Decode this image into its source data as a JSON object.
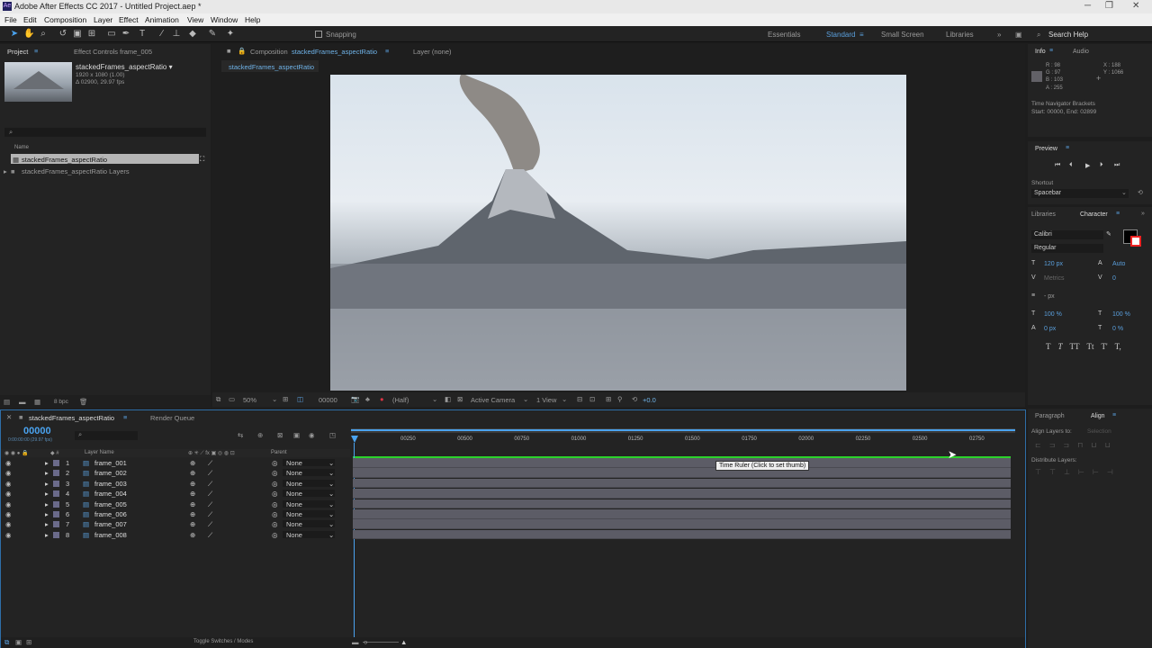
{
  "app": {
    "title": "Adobe After Effects CC 2017 - Untitled Project.aep *"
  },
  "menu": [
    "File",
    "Edit",
    "Composition",
    "Layer",
    "Effect",
    "Animation",
    "View",
    "Window",
    "Help"
  ],
  "toolbar": {
    "snapping": "Snapping",
    "workspaces": [
      "Essentials",
      "Standard",
      "Small Screen",
      "Libraries"
    ],
    "search": "Search Help"
  },
  "project": {
    "tab": "Project",
    "effect_controls": "Effect Controls frame_005",
    "item_name": "stackedFrames_aspectRatio ▾",
    "item_dims": "1920 x 1080 (1.00)",
    "item_dur": "Δ 02900, 29.97 fps",
    "col_name": "Name",
    "items": [
      "stackedFrames_aspectRatio",
      "stackedFrames_aspectRatio Layers"
    ],
    "bpc": "8 bpc"
  },
  "composition": {
    "tab_prefix": "Composition",
    "tab_name": "stackedFrames_aspectRatio",
    "layer_tab": "Layer (none)",
    "subtab": "stackedFrames_aspectRatio",
    "zoom": "50%",
    "timecode": "00000",
    "resolution": "(Half)",
    "camera": "Active Camera",
    "views": "1 View",
    "exposure": "+0.0"
  },
  "info": {
    "tab": "Info",
    "audio": "Audio",
    "r": "R : 98",
    "g": "G : 97",
    "b": "B : 103",
    "a": "A : 255",
    "x": "X : 188",
    "y": "Y : 1066",
    "nav1": "Time Navigator Brackets",
    "nav2": "Start: 00000, End: 02899"
  },
  "preview": {
    "tab": "Preview",
    "shortcut_label": "Shortcut",
    "shortcut": "Spacebar"
  },
  "character": {
    "libraries": "Libraries",
    "tab": "Character",
    "font": "Calibri",
    "style": "Regular",
    "size": "120 px",
    "leading": "Auto",
    "kerning": "Metrics",
    "tracking": "0",
    "stroke": "- px",
    "vscale": "100 %",
    "hscale": "100 %",
    "baseline": "0 px",
    "tsume": "0 %",
    "buttons": [
      "T",
      "T",
      "TT",
      "Tt",
      "T'",
      "T,"
    ]
  },
  "align": {
    "paragraph": "Paragraph",
    "tab": "Align",
    "align_to": "Align Layers to:",
    "selection": "Selection",
    "distribute": "Distribute Layers:"
  },
  "timeline": {
    "tab": "stackedFrames_aspectRatio",
    "render_queue": "Render Queue",
    "time": "00000",
    "fps": "0:00:00:00 (29.97 fps)",
    "layer_name_col": "Layer Name",
    "parent_col": "Parent",
    "ticks": [
      "00250",
      "00500",
      "00750",
      "01000",
      "01250",
      "01500",
      "01750",
      "02000",
      "02250",
      "02500",
      "02750"
    ],
    "tooltip": "Time Ruler (Click to set thumb)",
    "toggle": "Toggle Switches / Modes",
    "layers": [
      {
        "n": "1",
        "name": "frame_001",
        "parent": "None"
      },
      {
        "n": "2",
        "name": "frame_002",
        "parent": "None"
      },
      {
        "n": "3",
        "name": "frame_003",
        "parent": "None"
      },
      {
        "n": "4",
        "name": "frame_004",
        "parent": "None"
      },
      {
        "n": "5",
        "name": "frame_005",
        "parent": "None"
      },
      {
        "n": "6",
        "name": "frame_006",
        "parent": "None"
      },
      {
        "n": "7",
        "name": "frame_007",
        "parent": "None"
      },
      {
        "n": "8",
        "name": "frame_008",
        "parent": "None"
      }
    ]
  },
  "colors": {
    "accent": "#5a9fdc",
    "bg": "#232323",
    "track": "#5c5c66",
    "workarea": "#2bd22b"
  }
}
